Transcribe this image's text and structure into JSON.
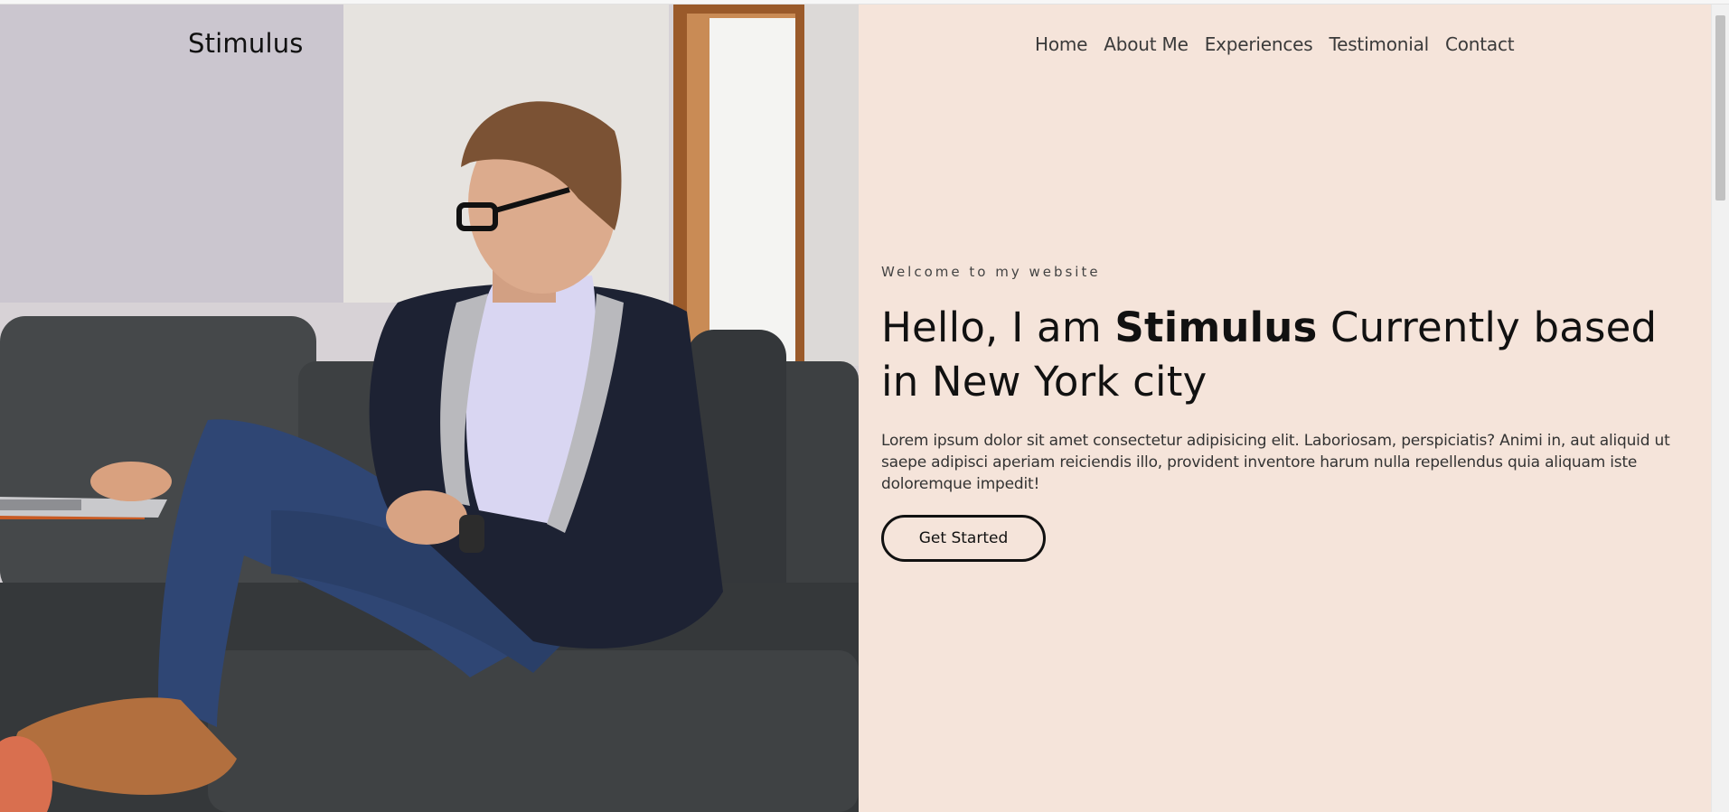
{
  "brand": {
    "name": "Stimulus"
  },
  "nav": {
    "items": [
      {
        "label": "Home"
      },
      {
        "label": "About Me"
      },
      {
        "label": "Experiences"
      },
      {
        "label": "Testimonial"
      },
      {
        "label": "Contact"
      }
    ]
  },
  "hero": {
    "welcome": "Welcome to my website",
    "headline_pre": "Hello, I am ",
    "headline_name": "Stimulus",
    "headline_post": " Currently based in New York city",
    "lead": "Lorem ipsum dolor sit amet consectetur adipisicing elit. Laboriosam, perspiciatis? Animi in, aut aliquid ut saepe adipisci aperiam reiciendis illo, provident inventore harum nulla repellendus quia aliquam iste doloremque impedit!",
    "cta_label": "Get Started"
  },
  "colors": {
    "content_background": "#f5e4da",
    "text_dark": "#111111",
    "sofa": "#3f4244",
    "jacket": "#1d2233",
    "shirt": "#d9d6f2",
    "jeans": "#2f4674"
  },
  "scroll": {
    "position": 0
  }
}
